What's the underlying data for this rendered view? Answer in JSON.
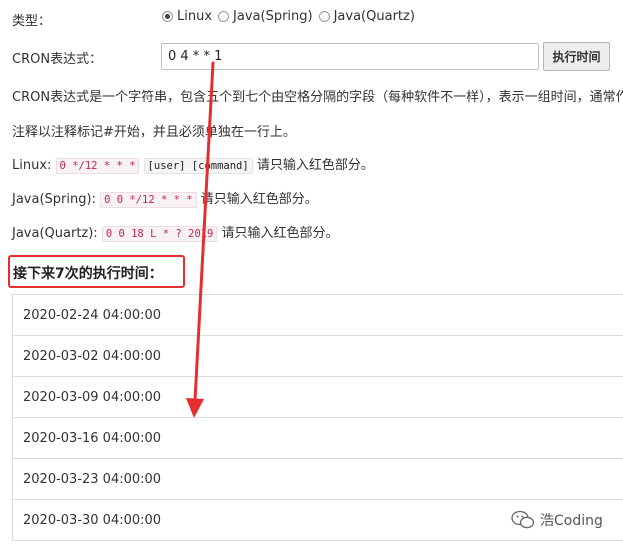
{
  "type_label": "类型：",
  "type_options": [
    {
      "label": "Linux",
      "checked": true
    },
    {
      "label": "Java(Spring)",
      "checked": false
    },
    {
      "label": "Java(Quartz)",
      "checked": false
    }
  ],
  "cron_label": "CRON表达式：",
  "cron_value": "0 4 * * 1",
  "run_button": "执行时间",
  "description_1": "CRON表达式是一个字符串，包含五个到七个由空格分隔的字段（每种软件不一样），表示一组时间，通常作",
  "description_2": "注释以注释标记#开始，并且必须单独在一行上。",
  "examples": {
    "linux": {
      "label": "Linux:",
      "code_red": "0 */12 * * *",
      "code_dark": "[user] [command]",
      "hint": "请只输入红色部分。"
    },
    "spring": {
      "label": "Java(Spring):",
      "code_red": "0 0 */12 * * *",
      "hint": "请只输入红色部分。"
    },
    "quartz": {
      "label": "Java(Quartz):",
      "code_red": "0 0 18 L * ? 2019",
      "hint": "请只输入红色部分。"
    }
  },
  "next_times_heading": "接下来7次的执行时间：",
  "next_times": [
    "2020-02-24 04:00:00",
    "2020-03-02 04:00:00",
    "2020-03-09 04:00:00",
    "2020-03-16 04:00:00",
    "2020-03-23 04:00:00",
    "2020-03-30 04:00:00"
  ],
  "watermark": "浩Coding",
  "colors": {
    "annotation_red": "#e52e2e",
    "code_red": "#c7254e"
  }
}
